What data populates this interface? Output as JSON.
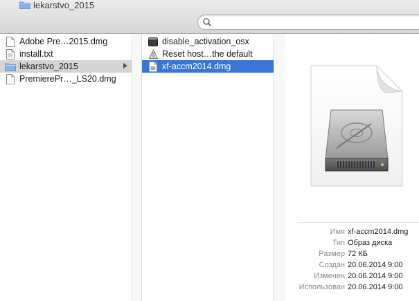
{
  "window": {
    "title": "lekarstvo_2015"
  },
  "search": {
    "placeholder": ""
  },
  "column1": {
    "items": [
      {
        "label": "Adobe Pre…2015.dmg",
        "icon": "document-icon"
      },
      {
        "label": "install.txt",
        "icon": "text-file-icon"
      },
      {
        "label": "lekarstvo_2015",
        "icon": "folder-icon",
        "selected": true
      },
      {
        "label": "PremierePr…_LS20.dmg",
        "icon": "document-icon"
      }
    ]
  },
  "column2": {
    "items": [
      {
        "label": "disable_activation_osx",
        "icon": "terminal-icon"
      },
      {
        "label": "Reset host…the default",
        "icon": "script-icon"
      },
      {
        "label": "xf-accm2014.dmg",
        "icon": "disk-image-icon",
        "selected": true
      }
    ]
  },
  "preview": {
    "icon": "hard-disk-icon",
    "info": [
      {
        "key": "Имя",
        "value": "xf-accm2014.dmg"
      },
      {
        "key": "Тип",
        "value": "Образ диска"
      },
      {
        "key": "Размер",
        "value": "72 КБ"
      },
      {
        "key": "Создан",
        "value": "20.06.2014 9:00"
      },
      {
        "key": "Изменен",
        "value": "20.06.2014 9:00"
      },
      {
        "key": "Использован",
        "value": "20.06.2014 9:00"
      }
    ]
  },
  "colors": {
    "selection_blue": "#3875d7",
    "selection_gray": "#d4d4d4"
  }
}
